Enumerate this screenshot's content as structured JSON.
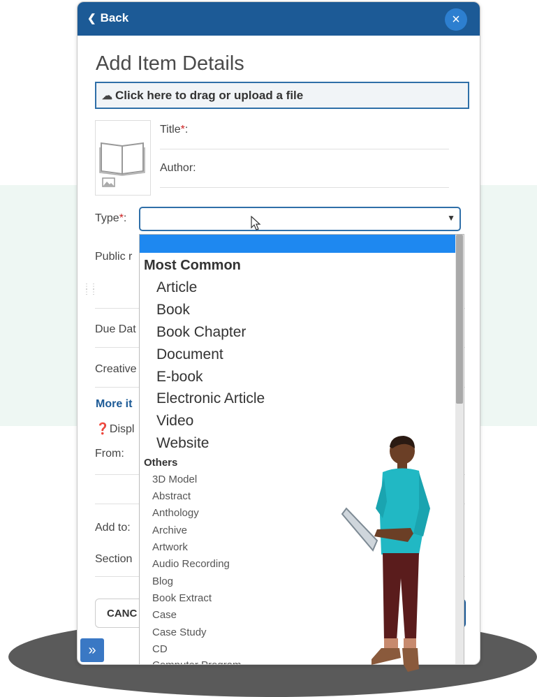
{
  "header": {
    "back_label": "Back",
    "close_label": "×"
  },
  "page_title": "Add Item Details",
  "upload": {
    "label": "Click here to drag or upload a file"
  },
  "fields": {
    "title_label": "Title",
    "title_suffix": ":",
    "author_label": "Author:",
    "type_label": "Type",
    "type_suffix": ":",
    "required_mark": "*"
  },
  "background_form": {
    "public_label": "Public r",
    "due_label": "Due Dat",
    "creative_label": "Creative",
    "more_label": "More it",
    "display_label": "Displ",
    "from_label": "From:",
    "add_to_label": "Add to:",
    "section_label": "Section"
  },
  "buttons": {
    "cancel_label": "CANC",
    "expand_label": "»"
  },
  "dropdown": {
    "group_common": "Most Common",
    "common_items": [
      "Article",
      "Book",
      "Book Chapter",
      "Document",
      "E-book",
      "Electronic Article",
      "Video",
      "Website"
    ],
    "group_others": "Others",
    "other_items": [
      "3D Model",
      "Abstract",
      "Anthology",
      "Archive",
      "Artwork",
      "Audio Recording",
      "Blog",
      "Book Extract",
      "Case",
      "Case Study",
      "CD",
      "Computer Program"
    ]
  },
  "colors": {
    "header": "#1c5a96",
    "close_button": "#2d7fd0",
    "selected_option": "#1e88f0",
    "required": "#cc2222",
    "background_band": "#eef7f3"
  }
}
